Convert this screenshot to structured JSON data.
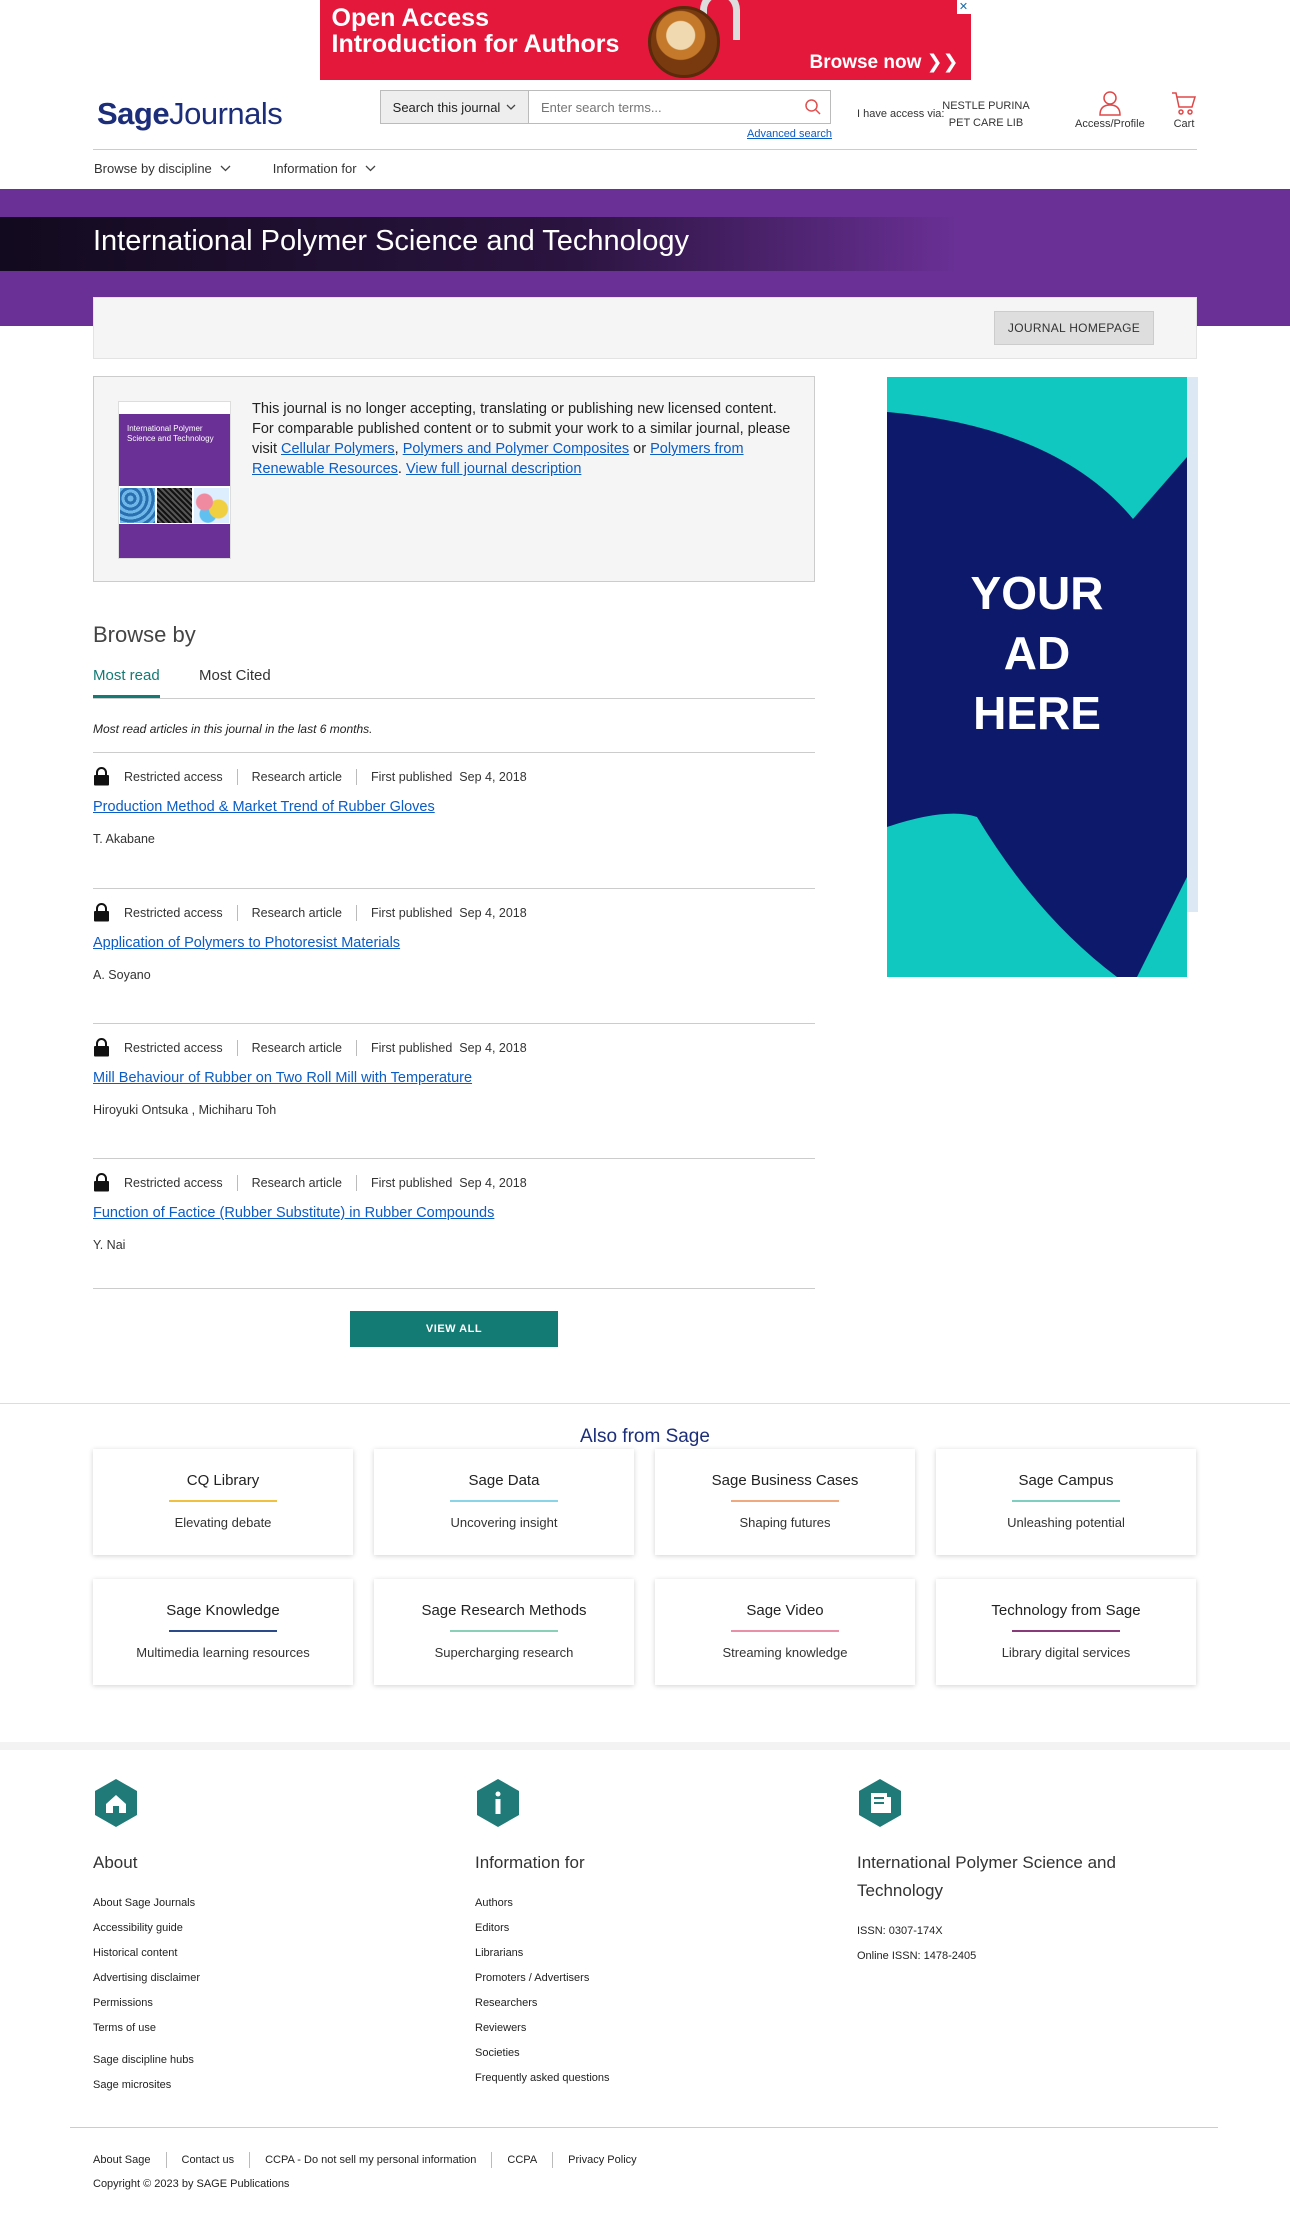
{
  "top_ad": {
    "line1": "Open Access",
    "line2": "Introduction for Authors",
    "cta": "Browse now ❯❯",
    "close": "✕"
  },
  "header": {
    "logo_bold": "Sage",
    "logo_rest": "Journals",
    "search_scope": "Search this journal",
    "search_placeholder": "Enter search terms...",
    "advanced_search": "Advanced search",
    "access_via": "I have access via:",
    "institution": "NESTLE PURINA PET CARE LIB",
    "access_profile": "Access/Profile",
    "cart": "Cart"
  },
  "subnav": {
    "browse_discipline": "Browse by discipline",
    "information_for": "Information for"
  },
  "journal": {
    "title": "International Polymer Science and Technology",
    "homepage_button": "JOURNAL HOMEPAGE",
    "cover_title": "International Polymer Science and Technology",
    "notice_prefix": "This journal is no longer accepting, translating or publishing new licensed content. For comparable published content or to submit your work to a similar journal, please visit ",
    "link1": "Cellular Polymers",
    "comma": ", ",
    "link2": "Polymers and Polymer Composites",
    "or": " or ",
    "link3": "Polymers from Renewable Resources",
    "period": ". ",
    "link4": "View full journal description"
  },
  "browse": {
    "title": "Browse by",
    "tabs": [
      "Most read",
      "Most Cited"
    ],
    "caption": "Most read articles in this journal in the last 6 months.",
    "articles": [
      {
        "access": "Restricted access",
        "type": "Research article",
        "published_label": "First published",
        "date": "Sep 4, 2018",
        "title": "Production Method & Market Trend of Rubber Gloves",
        "authors": "T. Akabane"
      },
      {
        "access": "Restricted access",
        "type": "Research article",
        "published_label": "First published",
        "date": "Sep 4, 2018",
        "title": "Application of Polymers to Photoresist Materials",
        "authors": "A. Soyano"
      },
      {
        "access": "Restricted access",
        "type": "Research article",
        "published_label": "First published",
        "date": "Sep 4, 2018",
        "title": "Mill Behaviour of Rubber on Two Roll Mill with Temperature",
        "authors": "Hiroyuki Ontsuka , Michiharu Toh"
      },
      {
        "access": "Restricted access",
        "type": "Research article",
        "published_label": "First published",
        "date": "Sep 4, 2018",
        "title": "Function of Factice (Rubber Substitute) in Rubber Compounds",
        "authors": "Y. Nai"
      }
    ],
    "view_all": "VIEW ALL"
  },
  "side_ad": {
    "line1": "YOUR",
    "line2": "AD",
    "line3": "HERE",
    "bg_color": "#0d1a6b",
    "accent_color": "#10c8c0"
  },
  "also": {
    "title": "Also from Sage",
    "cards": [
      {
        "title": "CQ Library",
        "subtitle": "Elevating debate",
        "color": "#f0c040"
      },
      {
        "title": "Sage Data",
        "subtitle": "Uncovering insight",
        "color": "#8ad4e8"
      },
      {
        "title": "Sage Business Cases",
        "subtitle": "Shaping futures",
        "color": "#f0a880"
      },
      {
        "title": "Sage Campus",
        "subtitle": "Unleashing potential",
        "color": "#7ecfc0"
      },
      {
        "title": "Sage Knowledge",
        "subtitle": "Multimedia learning resources",
        "color": "#2a4a8a"
      },
      {
        "title": "Sage Research Methods",
        "subtitle": "Supercharging research",
        "color": "#8ad0b8"
      },
      {
        "title": "Sage Video",
        "subtitle": "Streaming knowledge",
        "color": "#e890a8"
      },
      {
        "title": "Technology from Sage",
        "subtitle": "Library digital services",
        "color": "#8a3a7a"
      }
    ]
  },
  "footer": {
    "about_title": "About",
    "about_links": [
      "About Sage Journals",
      "Accessibility guide",
      "Historical content",
      "Advertising disclaimer",
      "Permissions",
      "Terms of use"
    ],
    "about_links2": [
      "Sage discipline hubs",
      "Sage microsites"
    ],
    "info_title": "Information for",
    "info_links": [
      "Authors",
      "Editors",
      "Librarians",
      "Promoters / Advertisers",
      "Researchers",
      "Reviewers",
      "Societies",
      "Frequently asked questions"
    ],
    "journal_title": "International Polymer Science and Technology",
    "issn": "ISSN: 0307-174X",
    "online_issn": "Online ISSN: 1478-2405",
    "bottom_links": [
      "About Sage",
      "Contact us",
      "CCPA - Do not sell my personal information",
      "CCPA",
      "Privacy Policy"
    ],
    "copyright": "Copyright © 2023 by SAGE Publications",
    "hex_color": "#1f7a78"
  }
}
